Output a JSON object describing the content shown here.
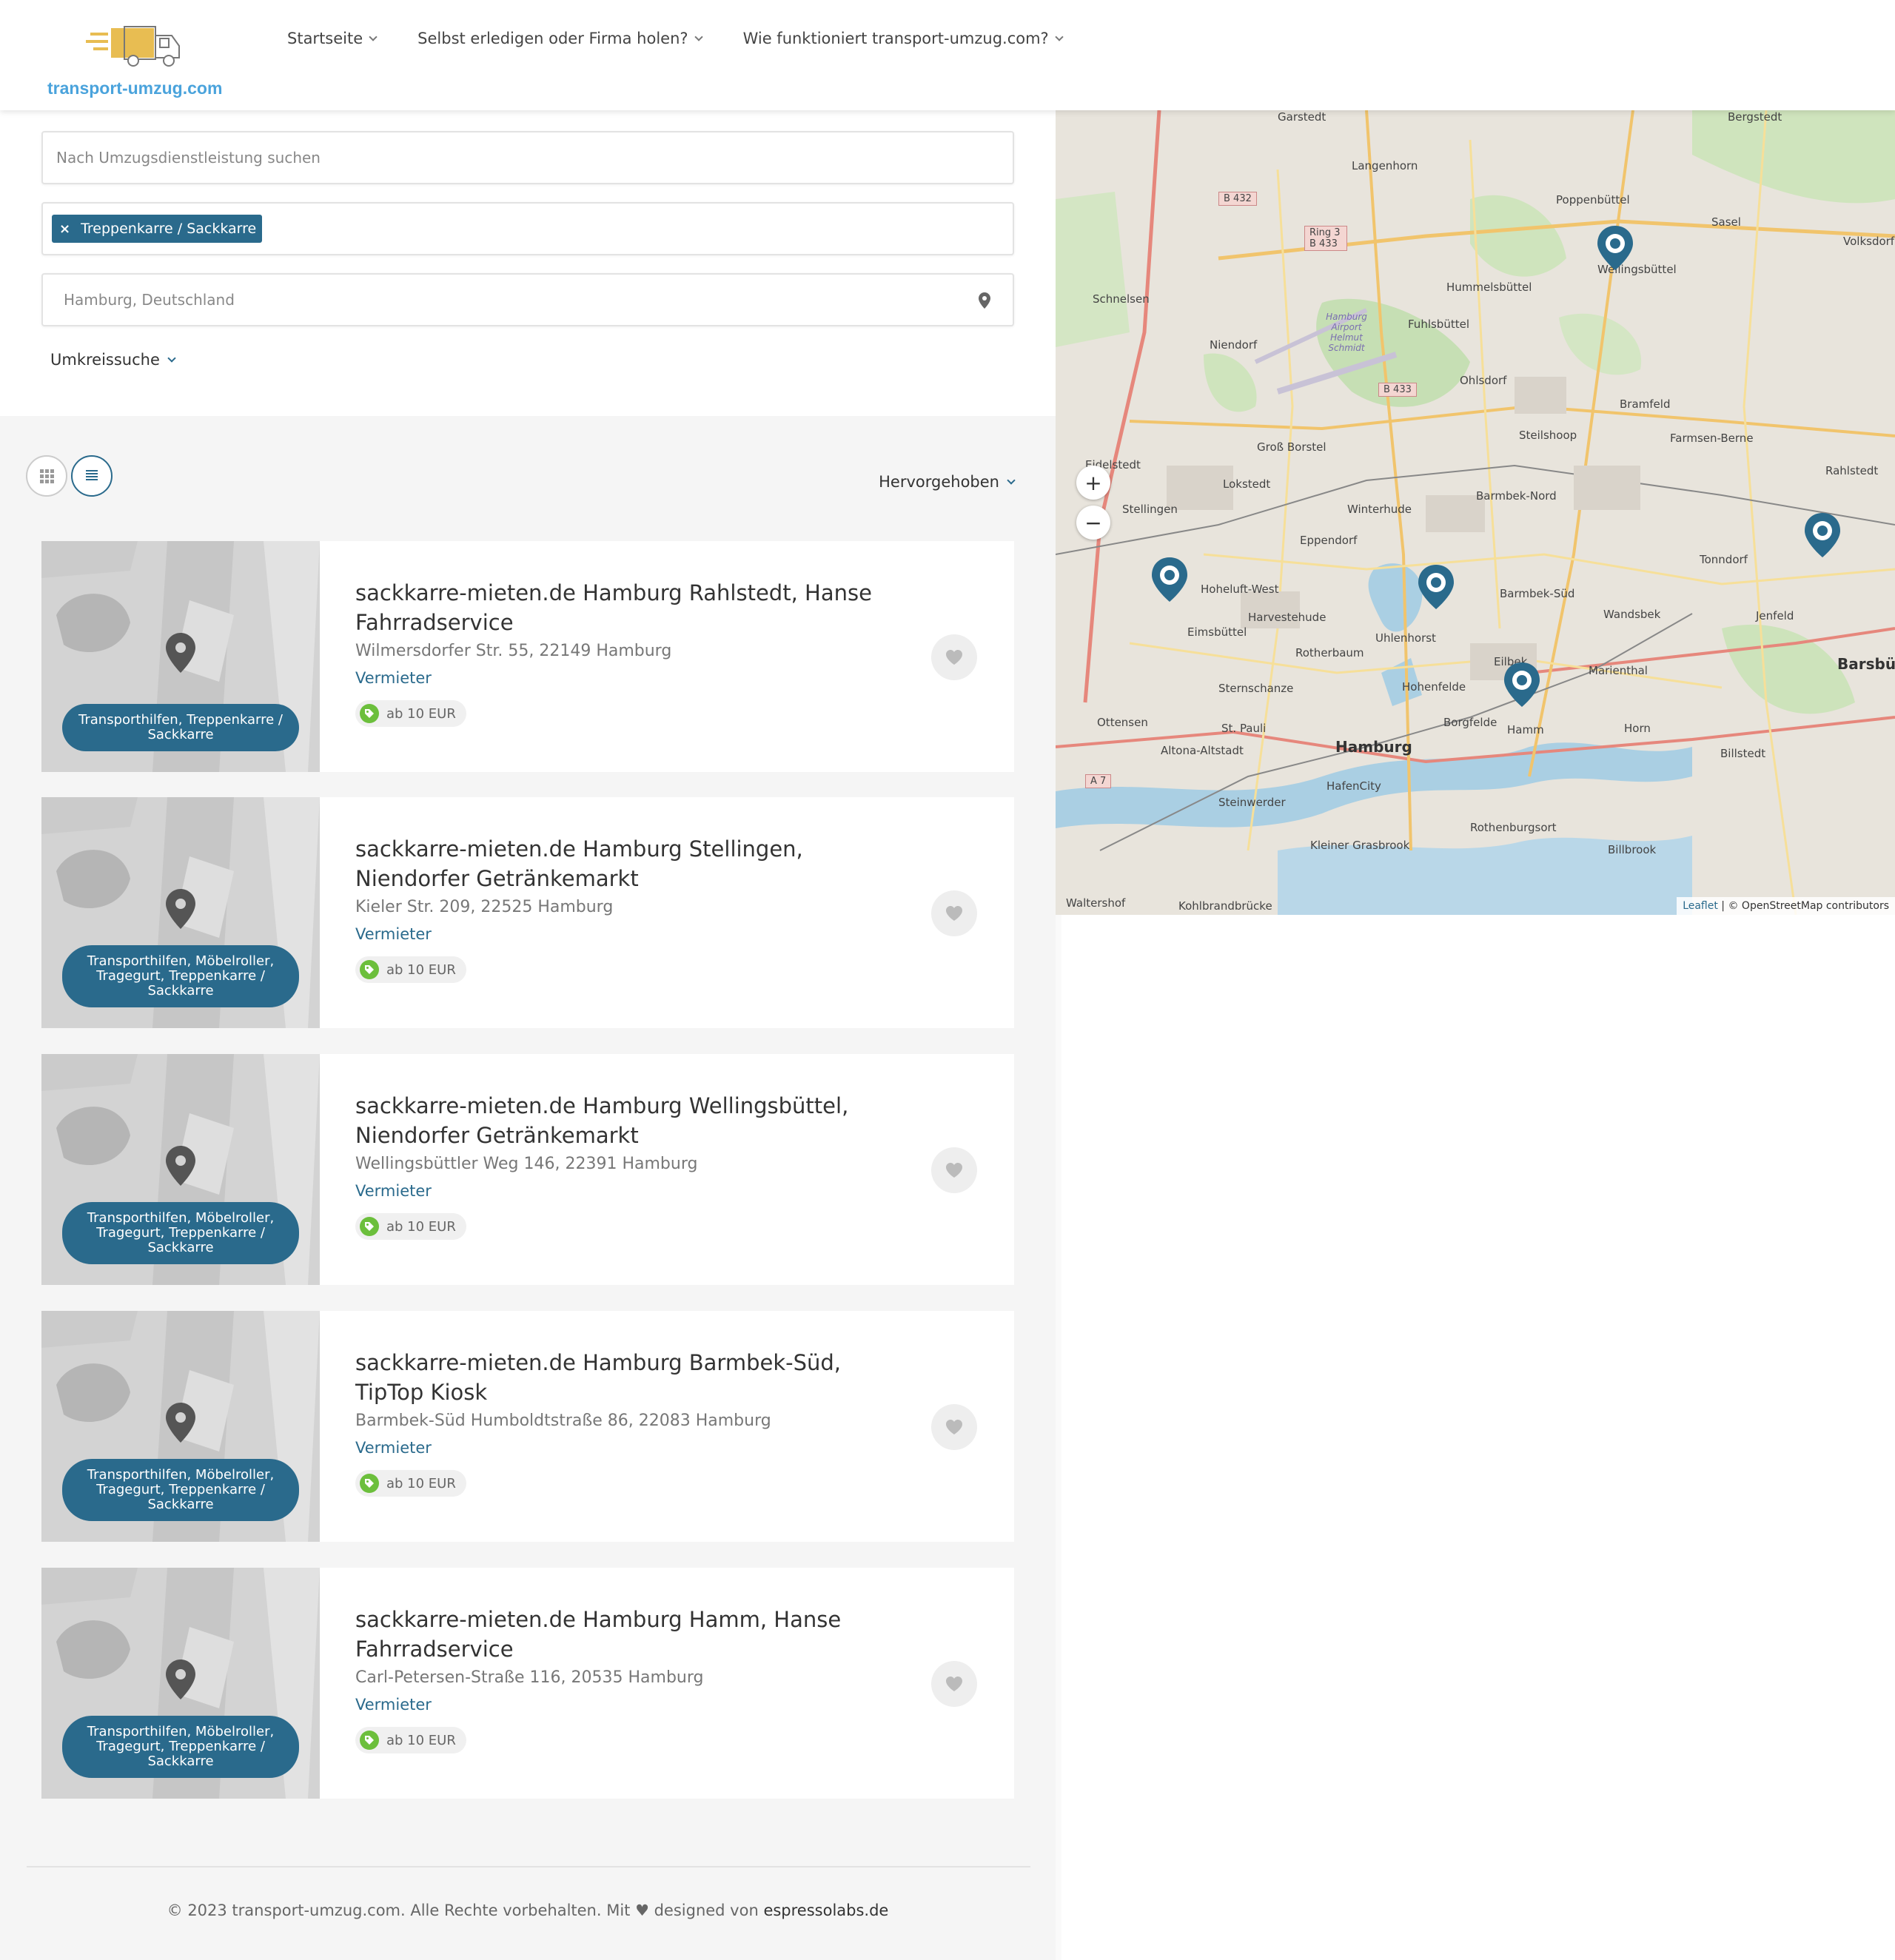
{
  "header": {
    "logo_text": "transport-umzug.com",
    "nav": [
      {
        "label": "Startseite"
      },
      {
        "label": "Selbst erledigen oder Firma holen?"
      },
      {
        "label": "Wie funktioniert transport-umzug.com?"
      }
    ]
  },
  "filters": {
    "search_placeholder": "Nach Umzugsdienstleistung suchen",
    "category_chip": "Treppenkarre / Sackkarre",
    "location_value": "Hamburg, Deutschland",
    "radius_label": "Umkreissuche"
  },
  "toolbar": {
    "sort_label": "Hervorgehoben",
    "view_grid_icon": "grid-icon",
    "view_list_icon": "list-icon"
  },
  "listings": [
    {
      "title": "sackkarre-mieten.de Hamburg Rahlstedt, Hanse Fahrradservice",
      "address": "Wilmersdorfer Str. 55, 22149 Hamburg",
      "role": "Vermieter",
      "price": "ab 10 EUR",
      "tags": "Transporthilfen, Treppenkarre / Sackkarre"
    },
    {
      "title": "sackkarre-mieten.de Hamburg Stellingen, Niendorfer Getränkemarkt",
      "address": "Kieler Str. 209, 22525 Hamburg",
      "role": "Vermieter",
      "price": "ab 10 EUR",
      "tags": "Transporthilfen, Möbelroller, Tragegurt, Treppenkarre / Sackkarre"
    },
    {
      "title": "sackkarre-mieten.de Hamburg Wellingsbüttel, Niendorfer Getränkemarkt",
      "address": "Wellingsbüttler Weg 146, 22391 Hamburg",
      "role": "Vermieter",
      "price": "ab 10 EUR",
      "tags": "Transporthilfen, Möbelroller, Tragegurt, Treppenkarre / Sackkarre"
    },
    {
      "title": "sackkarre-mieten.de Hamburg Barmbek-Süd, TipTop Kiosk",
      "address": "Barmbek-Süd Humboldtstraße 86, 22083 Hamburg",
      "role": "Vermieter",
      "price": "ab 10 EUR",
      "tags": "Transporthilfen, Möbelroller, Tragegurt, Treppenkarre / Sackkarre"
    },
    {
      "title": "sackkarre-mieten.de Hamburg Hamm, Hanse Fahrradservice",
      "address": "Carl-Petersen-Straße 116, 20535 Hamburg",
      "role": "Vermieter",
      "price": "ab 10 EUR",
      "tags": "Transporthilfen, Möbelroller, Tragegurt, Treppenkarre / Sackkarre"
    }
  ],
  "footer": {
    "text": "© 2023 transport-umzug.com. Alle Rechte vorbehalten. Mit ♥ designed von ",
    "brand": "espressolabs.de"
  },
  "map": {
    "zoom_in": "+",
    "zoom_out": "−",
    "attribution_leaflet": "Leaflet",
    "attribution_rest": " | © OpenStreetMap contributors",
    "labels": [
      "Garstedt",
      "Bergstedt",
      "Langenhorn",
      "Poppenbüttel",
      "Sasel",
      "Volksdorf",
      "Wellingsbüttel",
      "Hummelsbüttel",
      "Schnelsen",
      "Fuhlsbüttel",
      "Niendorf",
      "Ohlsdorf",
      "Bramfeld",
      "Steilshoop",
      "Farmsen-Berne",
      "Groß Borstel",
      "Eidelstedt",
      "Rahlstedt",
      "Lokstedt",
      "Barmbek-Nord",
      "Stellingen",
      "Winterhude",
      "Eppendorf",
      "Tonndorf",
      "Hoheluft-West",
      "Barmbek-Süd",
      "Harvestehude",
      "Wandsbek",
      "Jenfeld",
      "Eimsbüttel",
      "Uhlenhorst",
      "Rotherbaum",
      "Marienthal",
      "Barsbüttel",
      "Sternschanze",
      "Hohenfelde",
      "Eilbek",
      "Ottensen",
      "St. Pauli",
      "Borgfelde",
      "Hamm",
      "Horn",
      "Altona-Altstadt",
      "Hamburg",
      "Billstedt",
      "HafenCity",
      "Steinwerder",
      "Rothenburgsort",
      "Kleiner Grasbrook",
      "Billbrook",
      "Waltershof",
      "Kohlbrandbrücke",
      "B 432",
      "Ring 3 B 433",
      "B 433",
      "A 7",
      "Hamburg Airport Helmut Schmidt"
    ]
  }
}
